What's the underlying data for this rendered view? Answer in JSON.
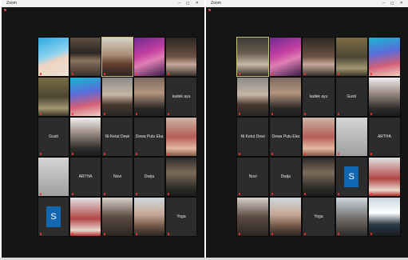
{
  "windows": [
    {
      "title": "Zoom",
      "view_label": "",
      "tiles": [
        {
          "type": "video",
          "active": false,
          "bg": "linear-gradient(160deg,#2aa9de 0%,#8fd3f0 45%,#f0d3c0 60%,#e9e2d6 100%)"
        },
        {
          "type": "video",
          "active": false,
          "bg": "linear-gradient(180deg,#5e4f40 0%,#2b2622 40%,#87725e 60%,#3a3029 100%)"
        },
        {
          "type": "video",
          "active": true,
          "bg": "linear-gradient(180deg,#d8d3c8 0%,#a88d77 45%,#613c2c 70%,#2b2623 100%)"
        },
        {
          "type": "video",
          "active": false,
          "bg": "linear-gradient(160deg,#6d2a92 0%,#c43fa0 40%,#e07fb4 60%,#3a1c4a 100%)"
        },
        {
          "type": "video",
          "active": false,
          "bg": "linear-gradient(180deg,#2c2723 0%,#6d5245 50%,#c7a99a 70%,#35302b 100%)"
        },
        {
          "type": "video",
          "active": false,
          "bg": "linear-gradient(180deg,#7b6d45 0%,#4b4532 50%,#a09670 80%,#3c3526 100%)"
        },
        {
          "type": "video",
          "active": false,
          "bg": "linear-gradient(170deg,#19b7d3 0%,#5c6bd8 40%,#d25f77 70%,#f2d0c0 100%)"
        },
        {
          "type": "video",
          "active": false,
          "bg": "linear-gradient(180deg,#8a8a8a 0%,#c6b6a6 45%,#4b3a31 70%,#262422 100%)"
        },
        {
          "type": "video",
          "active": false,
          "bg": "linear-gradient(180deg,#7a6a5d 0%,#b49580 40%,#2b2725 80%,#1e1e1e 100%)"
        },
        {
          "type": "name",
          "name": "kadek ayu",
          "active": false
        },
        {
          "type": "name",
          "name": "Gusti",
          "active": false
        },
        {
          "type": "video",
          "active": false,
          "bg": "linear-gradient(180deg,#efefef 0%,#9c8e86 40%,#2f2d2c 80%,#1a1a1a 100%)"
        },
        {
          "type": "name",
          "name": "Ni Ketut Dewi",
          "active": false
        },
        {
          "type": "name",
          "name": "Dewa Putu Eka",
          "active": false
        },
        {
          "type": "video",
          "active": false,
          "bg": "linear-gradient(180deg,#ccb6a5 0%,#b55d58 50%,#e4b9a0 80%,#7e5a4a 100%)"
        },
        {
          "type": "video",
          "active": false,
          "bg": "linear-gradient(180deg,#d5d5d5 0%,#9f9f9f 100%)"
        },
        {
          "type": "name",
          "name": "ARTHA",
          "active": false
        },
        {
          "type": "name",
          "name": "Novi",
          "active": false
        },
        {
          "type": "name",
          "name": "Dwija",
          "active": false
        },
        {
          "type": "video",
          "active": false,
          "bg": "linear-gradient(180deg,#2b2b2b 0%,#7d6a58 40%,#2c2b27 80%,#1a1a1a 100%)"
        },
        {
          "type": "avatar",
          "letter": "S",
          "active": false
        },
        {
          "type": "video",
          "active": false,
          "bg": "linear-gradient(180deg,#e2e2e2 0%,#b34646 55%,#e9d9cc 85%,#b22d2d 100%)"
        },
        {
          "type": "video",
          "active": false,
          "bg": "linear-gradient(180deg,#d8d0cb 0%,#5d4c43 50%,#2a2522 100%)"
        },
        {
          "type": "video",
          "active": false,
          "bg": "linear-gradient(180deg,#d1d7db 0%,#c4a696 45%,#6c5344 75%,#2a2624 100%)"
        },
        {
          "type": "name",
          "name": "Yoga",
          "active": false
        }
      ]
    },
    {
      "title": "Zoom",
      "view_label": "",
      "tiles": [
        {
          "type": "video",
          "active": true,
          "bg": "linear-gradient(180deg,#3a3a36 0%,#6c5c50 40%,#c6b8a6 70%,#2d2a26 100%)"
        },
        {
          "type": "video",
          "active": false,
          "bg": "linear-gradient(160deg,#6d2a92 0%,#c43fa0 40%,#e07fb4 60%,#3a1c4a 100%)"
        },
        {
          "type": "video",
          "active": false,
          "bg": "linear-gradient(180deg,#2c2723 0%,#6d5245 50%,#c7a99a 70%,#35302b 100%)"
        },
        {
          "type": "video",
          "active": false,
          "bg": "linear-gradient(180deg,#7b6d45 0%,#4b4532 50%,#a09670 80%,#3c3526 100%)"
        },
        {
          "type": "video",
          "active": false,
          "bg": "linear-gradient(170deg,#19b7d3 0%,#5c6bd8 40%,#d25f77 70%,#f2d0c0 100%)"
        },
        {
          "type": "video",
          "active": false,
          "bg": "linear-gradient(180deg,#8a8a8a 0%,#c6b6a6 45%,#4b3a31 70%,#262422 100%)"
        },
        {
          "type": "video",
          "active": false,
          "bg": "linear-gradient(180deg,#7a6a5d 0%,#b49580 40%,#2b2725 80%,#1e1e1e 100%)"
        },
        {
          "type": "name",
          "name": "kadek ayu",
          "active": false
        },
        {
          "type": "name",
          "name": "Gusti",
          "active": false
        },
        {
          "type": "video",
          "active": false,
          "bg": "linear-gradient(180deg,#efefef 0%,#9c8e86 40%,#2f2d2c 80%,#1a1a1a 100%)"
        },
        {
          "type": "name",
          "name": "Ni Ketut Dewi",
          "active": false
        },
        {
          "type": "name",
          "name": "Dewa Putu Eka",
          "active": false
        },
        {
          "type": "video",
          "active": false,
          "bg": "linear-gradient(180deg,#ccb6a5 0%,#b55d58 50%,#e4b9a0 80%,#7e5a4a 100%)"
        },
        {
          "type": "video",
          "active": false,
          "bg": "linear-gradient(180deg,#d5d5d5 0%,#9f9f9f 100%)"
        },
        {
          "type": "name",
          "name": "ARTHA",
          "active": false
        },
        {
          "type": "name",
          "name": "Novi",
          "active": false
        },
        {
          "type": "name",
          "name": "Dwija",
          "active": false
        },
        {
          "type": "video",
          "active": false,
          "bg": "linear-gradient(180deg,#2b2b2b 0%,#7d6a58 40%,#2c2b27 80%,#1a1a1a 100%)"
        },
        {
          "type": "avatar",
          "letter": "S",
          "active": false
        },
        {
          "type": "video",
          "active": false,
          "bg": "linear-gradient(180deg,#e2e2e2 0%,#b34646 55%,#e9d9cc 85%,#b22d2d 100%)"
        },
        {
          "type": "video",
          "active": false,
          "bg": "linear-gradient(180deg,#d8d0cb 0%,#5d4c43 50%,#2a2522 100%)"
        },
        {
          "type": "video",
          "active": false,
          "bg": "linear-gradient(180deg,#d1d7db 0%,#c4a696 45%,#6c5344 75%,#2a2624 100%)"
        },
        {
          "type": "name",
          "name": "Yoga",
          "active": false
        },
        {
          "type": "video",
          "active": false,
          "bg": "linear-gradient(180deg,#cfd8df 0%,#6f6c69 55%,#2c2a28 100%)"
        },
        {
          "type": "video",
          "active": false,
          "bg": "linear-gradient(180deg,#c9d5dc 0%,#ffffff 40%,#2b3a47 70%,#1b1b1b 100%)"
        }
      ]
    }
  ]
}
